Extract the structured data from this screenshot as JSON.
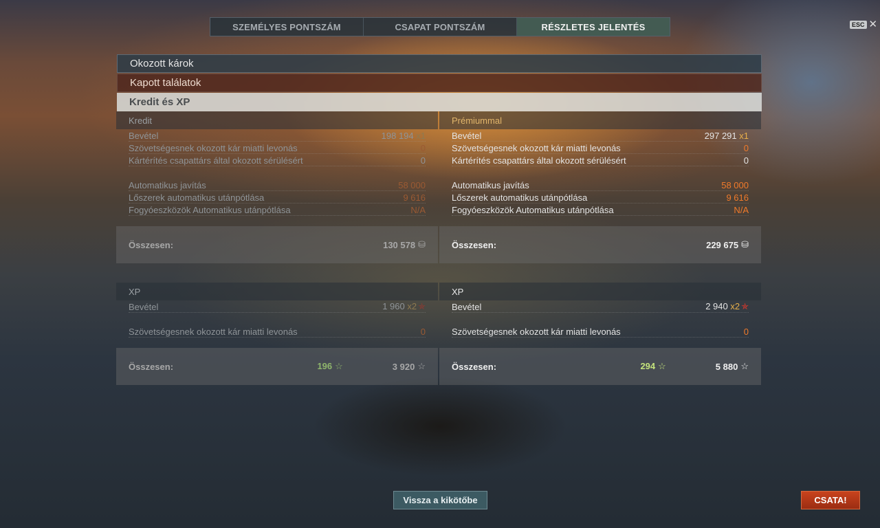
{
  "tabs": [
    {
      "label": "SZEMÉLYES PONTSZÁM",
      "active": false
    },
    {
      "label": "CSAPAT PONTSZÁM",
      "active": false
    },
    {
      "label": "RÉSZLETES JELENTÉS",
      "active": true
    }
  ],
  "esc": {
    "key": "ESC",
    "close": "✕"
  },
  "sections": {
    "damage": "Okozott károk",
    "hits": "Kapott találatok",
    "credits_xp": "Kredit és XP"
  },
  "credit": {
    "base": {
      "header": "Kredit",
      "income_label": "Bevétel",
      "income_value": "198 194",
      "income_mult": "x1",
      "ally_damage_label": "Szövetségesnek okozott kár miatti levonás",
      "ally_damage_value": "0",
      "compensation_label": "Kártérítés csapattárs által okozott sérülésért",
      "compensation_value": "0",
      "auto_repair_label": "Automatikus javítás",
      "auto_repair_value": "58 000",
      "auto_ammo_label": "Lőszerek automatikus utánpótlása",
      "auto_ammo_value": "9 616",
      "auto_consumables_label": "Fogyóeszközök Automatikus utánpótlása",
      "auto_consumables_value": "N/A",
      "total_label": "Összesen:",
      "total_value": "130 578"
    },
    "premium": {
      "header": "Prémiummal",
      "income_label": "Bevétel",
      "income_value": "297 291",
      "income_mult": "x1",
      "ally_damage_label": "Szövetségesnek okozott kár miatti levonás",
      "ally_damage_value": "0",
      "compensation_label": "Kártérítés csapattárs által okozott sérülésért",
      "compensation_value": "0",
      "auto_repair_label": "Automatikus javítás",
      "auto_repair_value": "58 000",
      "auto_ammo_label": "Lőszerek automatikus utánpótlása",
      "auto_ammo_value": "9 616",
      "auto_consumables_label": "Fogyóeszközök Automatikus utánpótlása",
      "auto_consumables_value": "N/A",
      "total_label": "Összesen:",
      "total_value": "229 675"
    }
  },
  "xp": {
    "base": {
      "header": "XP",
      "income_label": "Bevétel",
      "income_value": "1 960",
      "income_mult": "x2",
      "ally_damage_label": "Szövetségesnek okozott kár miatti levonás",
      "ally_damage_value": "0",
      "total_label": "Összesen:",
      "total_free": "196",
      "total_value": "3 920"
    },
    "premium": {
      "header": "XP",
      "income_label": "Bevétel",
      "income_value": "2 940",
      "income_mult": "x2",
      "ally_damage_label": "Szövetségesnek okozott kár miatti levonás",
      "ally_damage_value": "0",
      "total_label": "Összesen:",
      "total_free": "294",
      "total_value": "5 880"
    }
  },
  "icons": {
    "credit": "⛁",
    "star": "☆",
    "red_star": "✯"
  },
  "buttons": {
    "back": "Vissza a kikötőbe",
    "battle": "CSATA!"
  },
  "colors": {
    "accent_orange": "#f07a2a",
    "premium_gold": "#e2b66b",
    "battle_red": "#c9431d",
    "free_xp_green": "#c4e27c"
  }
}
